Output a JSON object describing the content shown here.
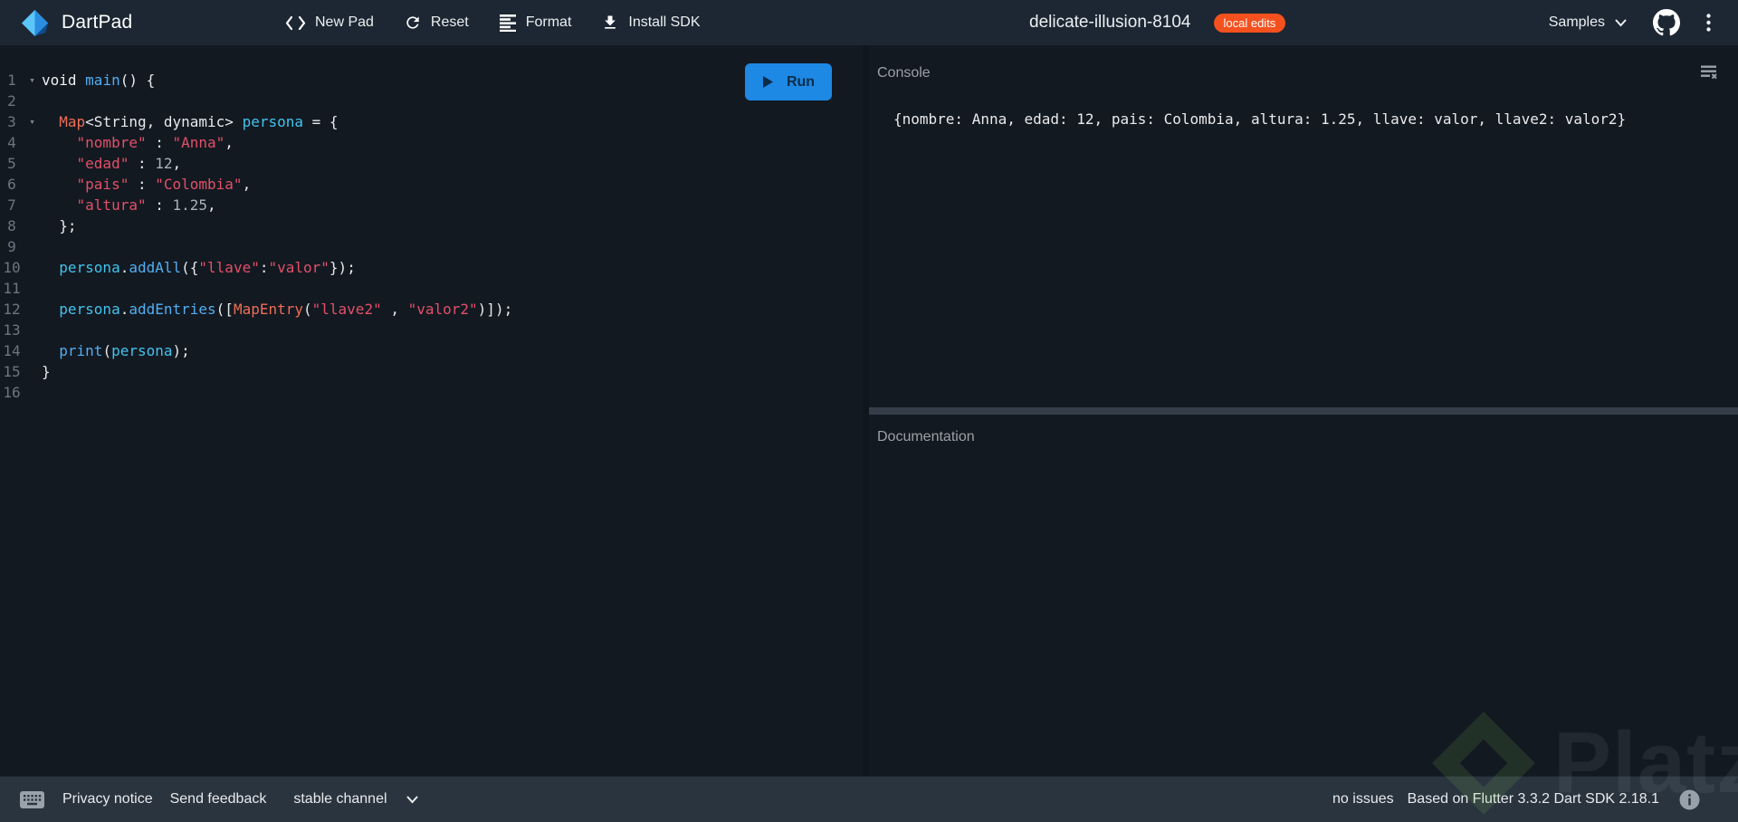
{
  "topbar": {
    "logo_text": "DartPad",
    "buttons": [
      {
        "label": "New Pad",
        "icon": "code-brackets-icon"
      },
      {
        "label": "Reset",
        "icon": "refresh-icon"
      },
      {
        "label": "Format",
        "icon": "format-align-icon"
      },
      {
        "label": "Install SDK",
        "icon": "download-icon"
      }
    ],
    "title": "delicate-illusion-8104",
    "badge": "local edits",
    "samples_label": "Samples",
    "icons_right": [
      "chevron-down-icon",
      "github-icon",
      "kebab-menu-icon"
    ]
  },
  "editor": {
    "run_label": "Run",
    "lines": [
      {
        "num": 1,
        "fold": true,
        "segs": [
          [
            "void ",
            "kw"
          ],
          [
            "main",
            "fn"
          ],
          [
            "() {",
            "pl"
          ]
        ]
      },
      {
        "num": 2,
        "fold": false,
        "segs": []
      },
      {
        "num": 3,
        "fold": true,
        "segs": [
          [
            "  ",
            "pl"
          ],
          [
            "Map",
            "ty"
          ],
          [
            "<String, dynamic> ",
            "pl"
          ],
          [
            "persona",
            "vr"
          ],
          [
            " = {",
            "pl"
          ]
        ]
      },
      {
        "num": 4,
        "fold": false,
        "segs": [
          [
            "    ",
            "pl"
          ],
          [
            "\"nombre\"",
            "st"
          ],
          [
            " : ",
            "pl"
          ],
          [
            "\"Anna\"",
            "st"
          ],
          [
            ",",
            "pl"
          ]
        ]
      },
      {
        "num": 5,
        "fold": false,
        "segs": [
          [
            "    ",
            "pl"
          ],
          [
            "\"edad\"",
            "st"
          ],
          [
            " : ",
            "pl"
          ],
          [
            "12",
            "nu"
          ],
          [
            ",",
            "pl"
          ]
        ]
      },
      {
        "num": 6,
        "fold": false,
        "segs": [
          [
            "    ",
            "pl"
          ],
          [
            "\"pais\"",
            "st"
          ],
          [
            " : ",
            "pl"
          ],
          [
            "\"Colombia\"",
            "st"
          ],
          [
            ",",
            "pl"
          ]
        ]
      },
      {
        "num": 7,
        "fold": false,
        "segs": [
          [
            "    ",
            "pl"
          ],
          [
            "\"altura\"",
            "st"
          ],
          [
            " : ",
            "pl"
          ],
          [
            "1.25",
            "nu"
          ],
          [
            ",",
            "pl"
          ]
        ]
      },
      {
        "num": 8,
        "fold": false,
        "segs": [
          [
            "  };",
            "pl"
          ]
        ]
      },
      {
        "num": 9,
        "fold": false,
        "segs": []
      },
      {
        "num": 10,
        "fold": false,
        "segs": [
          [
            "  ",
            "pl"
          ],
          [
            "persona",
            "vr"
          ],
          [
            ".",
            "pl"
          ],
          [
            "addAll",
            "fn"
          ],
          [
            "({",
            "pl"
          ],
          [
            "\"llave\"",
            "st"
          ],
          [
            ":",
            "pl"
          ],
          [
            "\"valor\"",
            "st"
          ],
          [
            "});",
            "pl"
          ]
        ]
      },
      {
        "num": 11,
        "fold": false,
        "segs": []
      },
      {
        "num": 12,
        "fold": false,
        "segs": [
          [
            "  ",
            "pl"
          ],
          [
            "persona",
            "vr"
          ],
          [
            ".",
            "pl"
          ],
          [
            "addEntries",
            "fn"
          ],
          [
            "([",
            "pl"
          ],
          [
            "MapEntry",
            "ty"
          ],
          [
            "(",
            "pl"
          ],
          [
            "\"llave2\"",
            "st"
          ],
          [
            " , ",
            "pl"
          ],
          [
            "\"valor2\"",
            "st"
          ],
          [
            ")]);",
            "pl"
          ]
        ]
      },
      {
        "num": 13,
        "fold": false,
        "segs": []
      },
      {
        "num": 14,
        "fold": false,
        "segs": [
          [
            "  ",
            "pl"
          ],
          [
            "print",
            "fn"
          ],
          [
            "(",
            "pl"
          ],
          [
            "persona",
            "vr"
          ],
          [
            ");",
            "pl"
          ]
        ]
      },
      {
        "num": 15,
        "fold": false,
        "segs": [
          [
            "}",
            "pl"
          ]
        ]
      },
      {
        "num": 16,
        "fold": false,
        "segs": []
      }
    ]
  },
  "console": {
    "header": "Console",
    "output": "{nombre: Anna, edad: 12, pais: Colombia, altura: 1.25, llave: valor, llave2: valor2}",
    "clear_icon": "clear-console-icon"
  },
  "documentation": {
    "header": "Documentation"
  },
  "statusbar": {
    "keyboard_icon": "keyboard-icon",
    "privacy": "Privacy notice",
    "feedback": "Send feedback",
    "channel": "stable channel",
    "issues": "no issues",
    "version": "Based on Flutter 3.3.2 Dart SDK 2.18.1",
    "info_icon": "info-icon"
  },
  "watermark": {
    "text": "Platzi",
    "logo": "platzi-diamond-logo"
  },
  "colors": {
    "topbar_bg": "#1C2733",
    "editor_bg": "#131921",
    "statusbar_bg": "#2A343E",
    "run_button": "#1E88E5",
    "badge_orange": "#F4511E",
    "syntax_string": "#E25068",
    "syntax_type": "#ED6E56",
    "syntax_function": "#51AEF2",
    "syntax_variable": "#42C3EE",
    "syntax_number": "#A8B2BC",
    "line_number": "#6B7680",
    "panel_header_text": "#9AA0A6"
  }
}
